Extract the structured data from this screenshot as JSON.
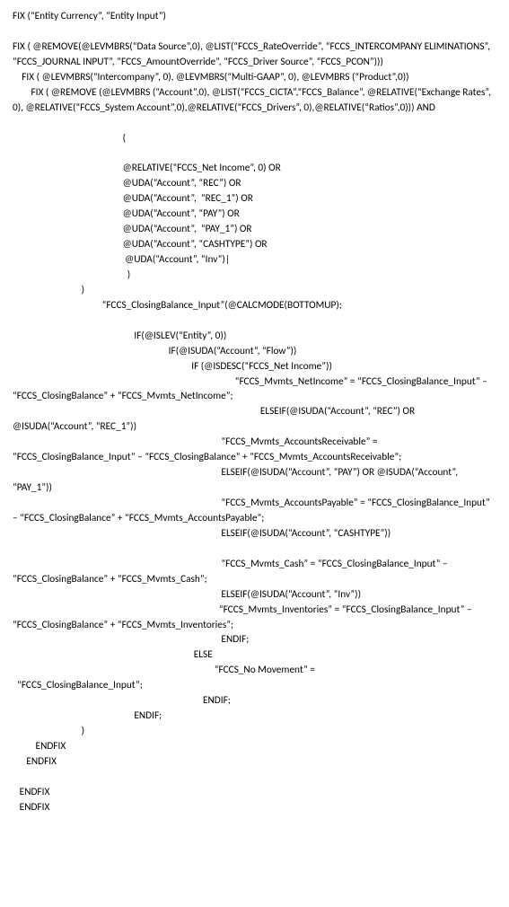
{
  "code": "FIX (“Entity Currency”, “Entity Input”)\n\nFIX ( @REMOVE(@LEVMBRS(“Data Source”,0), @LIST(“FCCS_RateOverride”, “FCCS_INTERCOMPANY ELIMINATIONS”, “FCCS_JOURNAL INPUT”, “FCCS_AmountOverride”, “FCCS_Driver Source”, “FCCS_PCON”)))\n    FIX ( @LEVMBRS(“Intercompany”, 0), @LEVMBRS(“Multi-GAAP”, 0), @LEVMBRS (“Product”,0))\n        FIX ( @REMOVE (@LEVMBRS (“Account”,0), @LIST(“FCCS_CICTA”,“FCCS_Balance”, @RELATIVE(“Exchange Rates”, 0), @RELATIVE(“FCCS_System Account”,0),@RELATIVE(“FCCS_Drivers”, 0),@RELATIVE(“Ratios”,0))) AND\n\n                                                (\n\n                                                @RELATIVE(“FCCS_Net Income”, 0) OR\n                                                @UDA(“Account”, “REC”) OR\n                                                @UDA(“Account”,  “REC_1”) OR\n                                                @UDA(“Account”, “PAY”) OR\n                                                @UDA(“Account”,  “PAY_1”) OR\n                                                @UDA(“Account”, “CASHTYPE”) OR\n                                                 @UDA(“Account”, “Inv”)|\n                                                  )\n                              )\n                                       “FCCS_ClosingBalance_Input”(@CALCMODE(BOTTOMUP);\n\n                                                     IF(@ISLEV(“Entity”, 0))\n                                                                    IF(@ISUDA(“Account”, “Flow”))\n                                                                              IF (@ISDESC(“FCCS_Net Income”))\n                                                                                                 “FCCS_Mvmts_NetIncome” = “FCCS_ClosingBalance_Input” – “FCCS_ClosingBalance” + “FCCS_Mvmts_NetIncome”;\n                                                                                                            ELSEIF(@ISUDA(“Account”, “REC”) OR @ISUDA(“Account”, “REC_1”))\n                                                                                           “FCCS_Mvmts_AccountsReceivable” = “FCCS_ClosingBalance_Input” – “FCCS_ClosingBalance” + “FCCS_Mvmts_AccountsReceivable”;\n                                                                                           ELSEIF(@ISUDA(“Account”, “PAY”) OR @ISUDA(“Account”,  “PAY_1”))\n                                                                                           “FCCS_Mvmts_AccountsPayable” = “FCCS_ClosingBalance_Input” – “FCCS_ClosingBalance” + “FCCS_Mvmts_AccountsPayable”;\n                                                                                           ELSEIF(@ISUDA(“Account”, “CASHTYPE”))\n\n                                                                                           “FCCS_Mvmts_Cash” = “FCCS_ClosingBalance_Input” – “FCCS_ClosingBalance” + “FCCS_Mvmts_Cash”;\n                                                                                           ELSEIF(@ISUDA(“Account”, “Inv”))\n                                                                                          “FCCS_Mvmts_Inventories” = “FCCS_ClosingBalance_Input” – “FCCS_ClosingBalance” + “FCCS_Mvmts_Inventories”;\n                                                                                           ENDIF;\n                                                                               ELSE\n                                                                                        “FCCS_No Movement” =\n  “FCCS_ClosingBalance_Input”;\n                                                                                   ENDIF;\n                                                     ENDIF;\n                              )\n          ENDFIX\n      ENDFIX\n\n   ENDFIX\n   ENDFIX"
}
